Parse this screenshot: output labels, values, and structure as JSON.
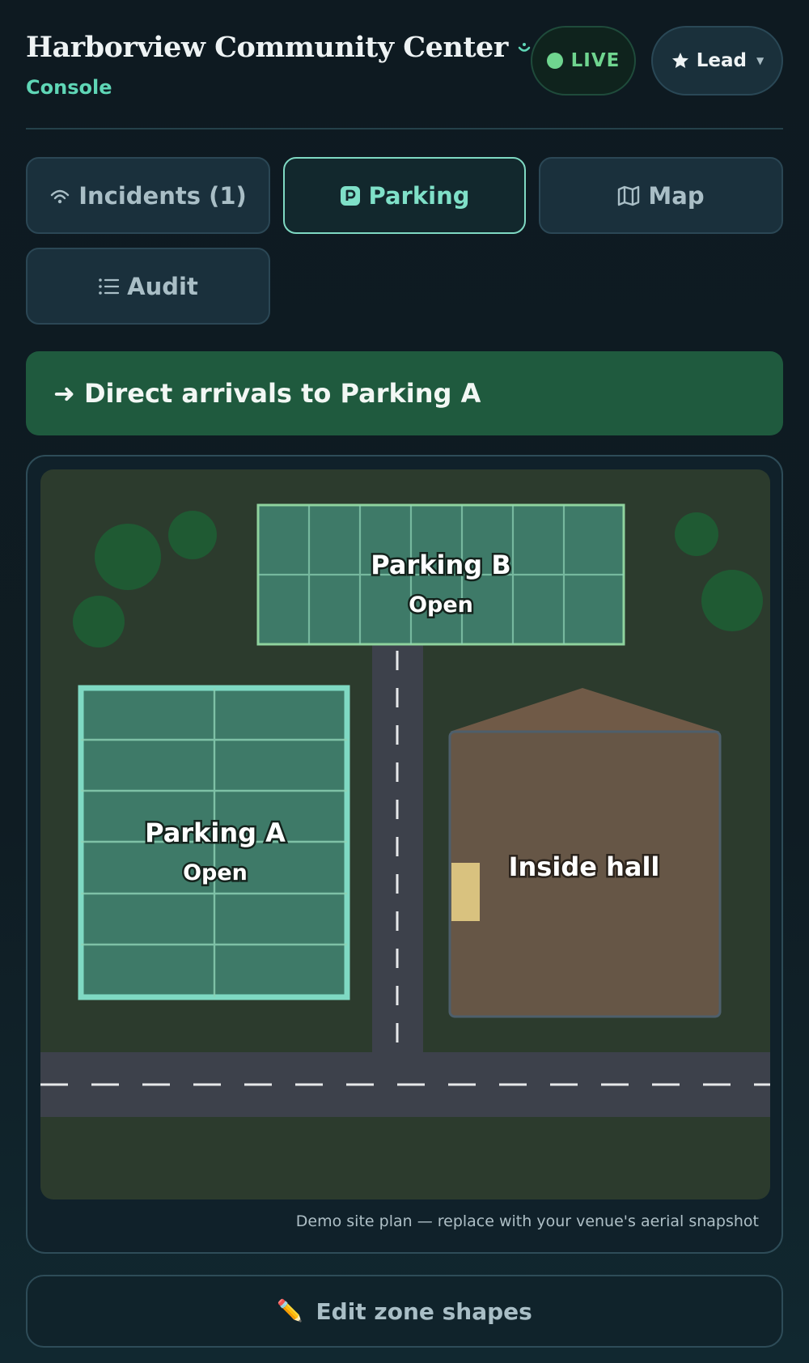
{
  "header": {
    "title": "Harborview Community Center",
    "subtitle": "Console",
    "live_label": "LIVE",
    "role_label": "Lead",
    "icons": {
      "title": "smile-icon",
      "live": "status-dot-icon",
      "role": "star-icon",
      "caret": "chevron-down-icon"
    }
  },
  "tabs": [
    {
      "label": "Incidents (1)",
      "icon": "signal-icon",
      "active": false
    },
    {
      "label": "Parking",
      "icon": "parking-icon",
      "active": true
    },
    {
      "label": "Map",
      "icon": "map-icon",
      "active": false
    },
    {
      "label": "Audit",
      "icon": "list-icon",
      "active": false
    }
  ],
  "banner": {
    "text": "➜ Direct arrivals to Parking A"
  },
  "site_plan": {
    "zones": {
      "parking_a": {
        "name": "Parking A",
        "status": "Open"
      },
      "parking_b": {
        "name": "Parking B",
        "status": "Open"
      },
      "hall": {
        "name": "Inside hall"
      }
    },
    "caption": "Demo site plan — replace with your venue's aerial snapshot"
  },
  "edit_button": {
    "label": "Edit zone shapes",
    "icon": "pencil-icon"
  },
  "colors": {
    "accent": "#7fd9c3",
    "live": "#6fd58f",
    "banner_bg": "#1f5a3e",
    "parking_fill": "#3e7a68",
    "hall_fill": "#665646",
    "grass": "#2c3b2d",
    "road": "#3d414b"
  }
}
